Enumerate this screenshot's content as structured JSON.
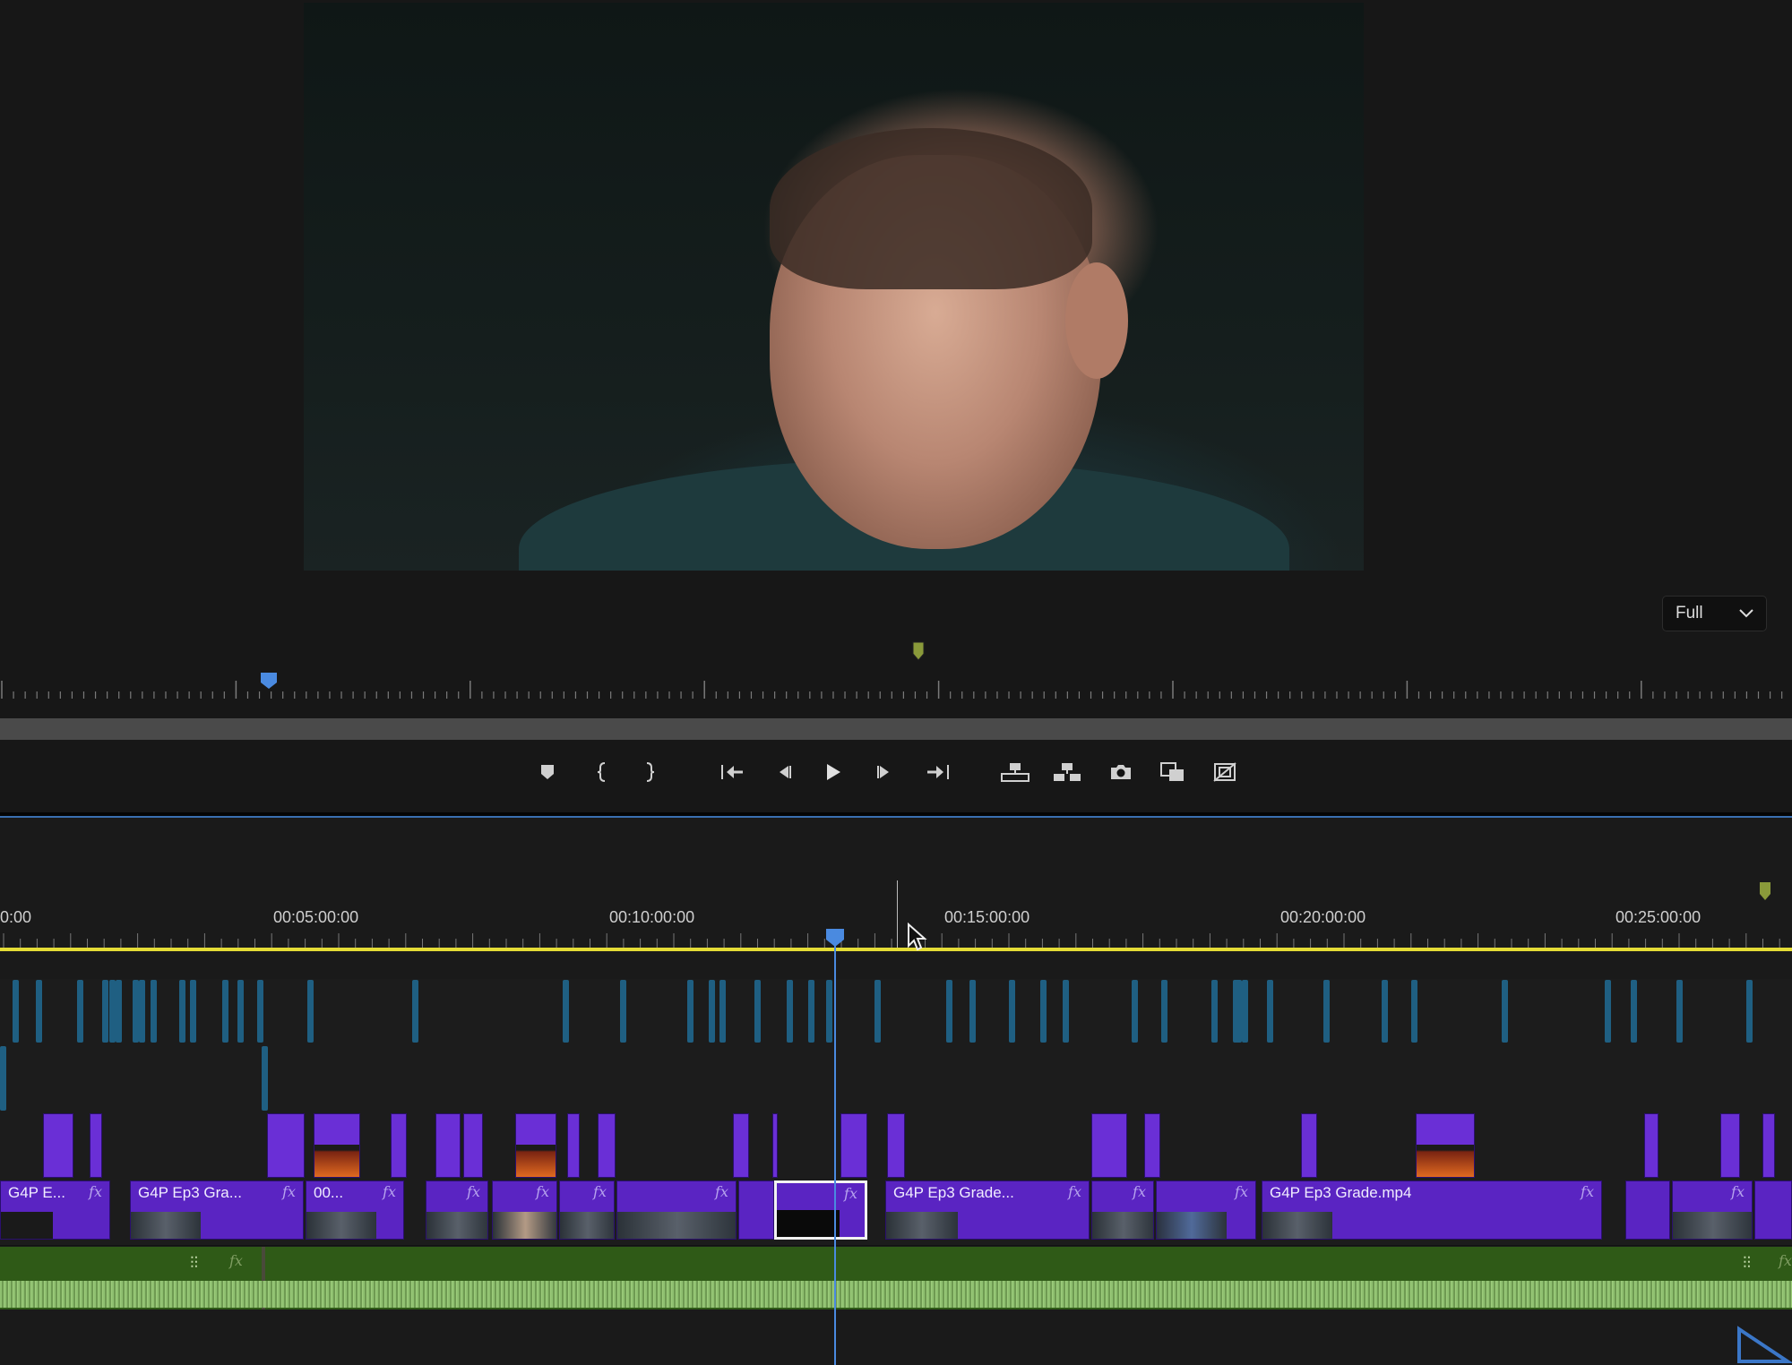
{
  "monitor": {
    "zoom_label": "Full",
    "zoom_icon": "chevron-down-icon"
  },
  "transport": {
    "buttons": [
      {
        "name": "add-marker-button",
        "icon": "marker-icon"
      },
      {
        "name": "mark-in-button",
        "icon": "bracket-left-icon"
      },
      {
        "name": "mark-out-button",
        "icon": "bracket-right-icon"
      },
      {
        "name": "go-to-in-button",
        "icon": "go-to-in-icon"
      },
      {
        "name": "step-back-button",
        "icon": "step-back-icon"
      },
      {
        "name": "play-button",
        "icon": "play-icon"
      },
      {
        "name": "step-forward-button",
        "icon": "step-forward-icon"
      },
      {
        "name": "go-to-out-button",
        "icon": "go-to-out-icon"
      },
      {
        "name": "lift-button",
        "icon": "lift-icon"
      },
      {
        "name": "extract-button",
        "icon": "extract-icon"
      },
      {
        "name": "export-frame-button",
        "icon": "camera-icon"
      },
      {
        "name": "comparison-view-button",
        "icon": "comparison-icon"
      },
      {
        "name": "safe-margins-button",
        "icon": "safe-margins-icon"
      }
    ]
  },
  "timeline": {
    "ruler": [
      "0:00",
      "00:05:00:00",
      "00:10:00:00",
      "00:15:00:00",
      "00:20:00:00",
      "00:25:00:00"
    ],
    "clips": {
      "c1": "G4P E...",
      "c2": "G4P Ep3 Gra...",
      "c3": "00...",
      "c4": "G4P Ep3 Grade...",
      "c5": "G4P Ep3 Grade.mp4"
    },
    "fx": "fx"
  }
}
